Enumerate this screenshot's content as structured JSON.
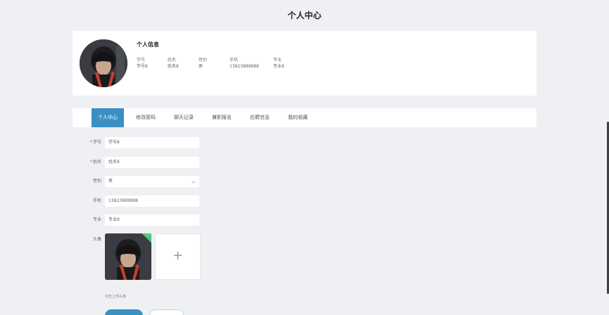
{
  "page": {
    "title": "个人中心"
  },
  "profile": {
    "section_title": "个人信息",
    "fields": [
      {
        "label": "学号",
        "value": "学号8"
      },
      {
        "label": "姓名",
        "value": "姓名8"
      },
      {
        "label": "性别",
        "value": "男"
      },
      {
        "label": "手机",
        "value": "13823888888"
      },
      {
        "label": "专业",
        "value": "专业8"
      }
    ]
  },
  "tabs": [
    {
      "label": "个人中心",
      "active": true
    },
    {
      "label": "修改密码",
      "active": false
    },
    {
      "label": "聊天记录",
      "active": false
    },
    {
      "label": "兼职报名",
      "active": false
    },
    {
      "label": "应聘信息",
      "active": false
    },
    {
      "label": "我的收藏",
      "active": false
    }
  ],
  "form": {
    "fields": [
      {
        "label": "学号",
        "required": true,
        "value": "学号8"
      },
      {
        "label": "姓名",
        "required": true,
        "value": "姓名8"
      },
      {
        "label": "性别",
        "required": false,
        "value": "男"
      },
      {
        "label": "手机",
        "required": false,
        "value": "13823888888"
      },
      {
        "label": "专业",
        "required": false,
        "value": "专业8"
      }
    ],
    "avatar_label": "头像",
    "upload_icon": "plus-icon",
    "upload_hint": "点击上传头像",
    "required_mark": "*"
  },
  "colors": {
    "accent": "#3b8fc4",
    "background": "#eef0f3",
    "success": "#4cc47a",
    "required": "#e04a4a"
  }
}
